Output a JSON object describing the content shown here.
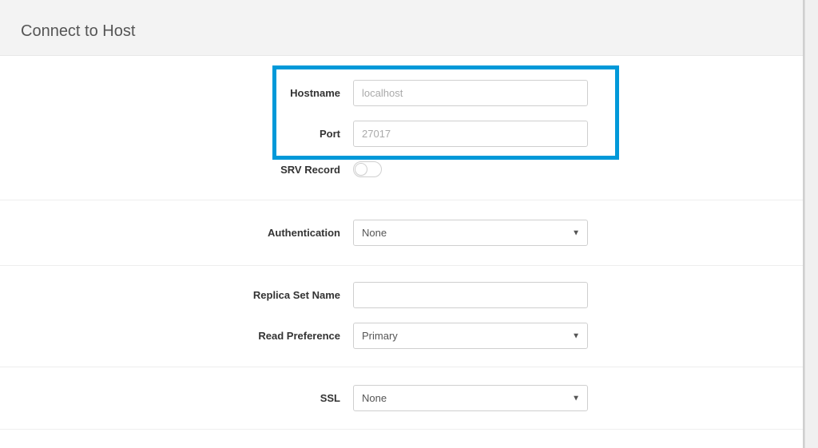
{
  "header": {
    "title": "Connect to Host"
  },
  "fields": {
    "hostname": {
      "label": "Hostname",
      "placeholder": "localhost",
      "value": ""
    },
    "port": {
      "label": "Port",
      "placeholder": "27017",
      "value": ""
    },
    "srv": {
      "label": "SRV Record",
      "on": false
    },
    "authentication": {
      "label": "Authentication",
      "selected": "None"
    },
    "replicaSet": {
      "label": "Replica Set Name",
      "value": ""
    },
    "readPreference": {
      "label": "Read Preference",
      "selected": "Primary"
    },
    "ssl": {
      "label": "SSL",
      "selected": "None"
    }
  }
}
